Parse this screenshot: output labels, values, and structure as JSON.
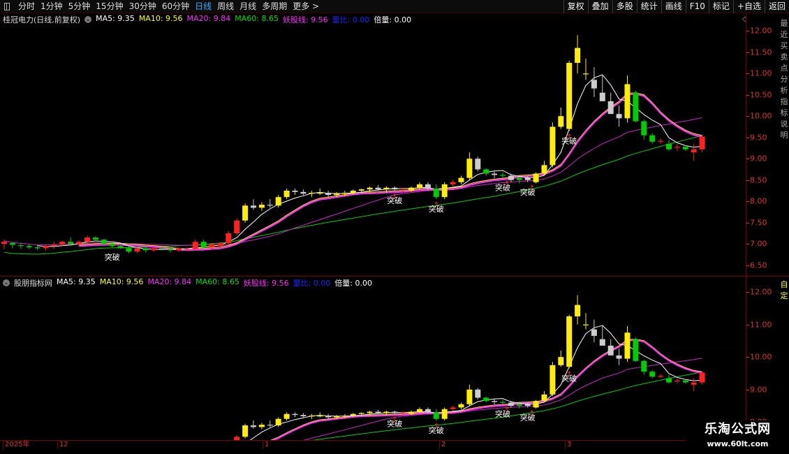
{
  "toolbar": {
    "tabs": [
      "分时",
      "1分钟",
      "5分钟",
      "15分钟",
      "30分钟",
      "60分钟",
      "日线",
      "周线",
      "月线",
      "多周期",
      "更多 >"
    ],
    "active_tab": "日线",
    "tools": [
      "复权",
      "叠加",
      "多股",
      "统计",
      "画线",
      "F10",
      "标记",
      "+自选",
      "返回"
    ]
  },
  "panel1": {
    "title": "桂冠电力(日线,前复权)",
    "indicators": [
      {
        "label": "MA5: 9.35",
        "color": "#ffffff"
      },
      {
        "label": "MA10: 9.56",
        "color": "#ffff00"
      },
      {
        "label": "MA20: 9.84",
        "color": "#ff2bff"
      },
      {
        "label": "MA60: 8.65",
        "color": "#00e000"
      },
      {
        "label": "妖股线: 9.56",
        "color": "#ff2bff"
      },
      {
        "label": "量比: 0.00",
        "color": "#2222ff"
      },
      {
        "label": "倍量: 0.00",
        "color": "#ffffff"
      }
    ],
    "ticks": [
      "12.00",
      "11.50",
      "11.00",
      "10.50",
      "10.00",
      "9.50",
      "9.00",
      "8.50",
      "8.00",
      "7.50",
      "7.00",
      "6.50"
    ],
    "side_text": "最近买卖点分析指标说明"
  },
  "panel2": {
    "title": "股朋指标网",
    "indicators": [
      {
        "label": "MA5: 9.35",
        "color": "#ffffff"
      },
      {
        "label": "MA10: 9.56",
        "color": "#ffff00"
      },
      {
        "label": "MA20: 9.84",
        "color": "#ff2bff"
      },
      {
        "label": "MA60: 8.65",
        "color": "#00e000"
      },
      {
        "label": "妖股线: 9.56",
        "color": "#ff2bff"
      },
      {
        "label": "量比: 0.00",
        "color": "#2222ff"
      },
      {
        "label": "倍量: 0.00",
        "color": "#ffffff"
      }
    ],
    "ticks": [
      "12.00",
      "11.00",
      "10.00",
      "9.00",
      "8.00"
    ],
    "side_text": "自定"
  },
  "signal_label": "突破",
  "dates": [
    "2025年",
    "12",
    "1",
    "2",
    "3"
  ],
  "watermark": {
    "line1": "乐淘公式网",
    "line2": "www.60lt.com"
  },
  "chart_data": {
    "type": "candlestick",
    "ohlc": [
      [
        7.0,
        7.1,
        6.88,
        7.05
      ],
      [
        7.02,
        7.05,
        6.9,
        6.98
      ],
      [
        6.97,
        7.02,
        6.88,
        6.95
      ],
      [
        6.95,
        7.0,
        6.88,
        6.92
      ],
      [
        6.92,
        6.98,
        6.85,
        6.9
      ],
      [
        6.9,
        6.98,
        6.85,
        6.95
      ],
      [
        6.95,
        7.05,
        6.88,
        6.98
      ],
      [
        6.98,
        7.08,
        6.95,
        7.05
      ],
      [
        7.05,
        7.15,
        6.95,
        7.0
      ],
      [
        7.0,
        7.08,
        6.95,
        7.05
      ],
      [
        7.05,
        7.2,
        7.0,
        7.15
      ],
      [
        7.15,
        7.18,
        7.05,
        7.1
      ],
      [
        7.1,
        7.12,
        6.95,
        7.0
      ],
      [
        7.0,
        7.05,
        6.92,
        6.95
      ],
      [
        6.95,
        7.0,
        6.88,
        6.9
      ],
      [
        6.9,
        6.95,
        6.78,
        6.82
      ],
      [
        6.82,
        6.92,
        6.78,
        6.9
      ],
      [
        6.9,
        6.95,
        6.8,
        6.85
      ],
      [
        6.85,
        6.92,
        6.82,
        6.9
      ],
      [
        6.9,
        6.95,
        6.85,
        6.88
      ],
      [
        6.88,
        6.92,
        6.8,
        6.85
      ],
      [
        6.85,
        6.92,
        6.82,
        6.9
      ],
      [
        6.88,
        6.92,
        6.84,
        6.88
      ],
      [
        6.88,
        7.1,
        6.85,
        7.05
      ],
      [
        7.05,
        7.1,
        6.9,
        6.92
      ],
      [
        6.92,
        7.02,
        6.88,
        7.0
      ],
      [
        6.95,
        7.05,
        6.92,
        7.02
      ],
      [
        7.02,
        7.3,
        7.0,
        7.25
      ],
      [
        7.25,
        7.6,
        7.2,
        7.55
      ],
      [
        7.55,
        7.95,
        7.5,
        7.9
      ],
      [
        7.9,
        8.05,
        7.8,
        7.85
      ],
      [
        7.85,
        7.98,
        7.78,
        7.92
      ],
      [
        7.92,
        8.05,
        7.85,
        7.9
      ],
      [
        7.9,
        8.15,
        7.85,
        8.1
      ],
      [
        8.1,
        8.3,
        8.05,
        8.25
      ],
      [
        8.25,
        8.3,
        8.15,
        8.22
      ],
      [
        8.22,
        8.28,
        8.15,
        8.18
      ],
      [
        8.18,
        8.25,
        8.1,
        8.2
      ],
      [
        8.2,
        8.3,
        8.15,
        8.2
      ],
      [
        8.2,
        8.25,
        8.1,
        8.15
      ],
      [
        8.15,
        8.22,
        8.1,
        8.18
      ],
      [
        8.18,
        8.25,
        8.12,
        8.2
      ],
      [
        8.2,
        8.28,
        8.15,
        8.25
      ],
      [
        8.25,
        8.3,
        8.18,
        8.28
      ],
      [
        8.28,
        8.35,
        8.2,
        8.32
      ],
      [
        8.32,
        8.38,
        8.25,
        8.28
      ],
      [
        8.28,
        8.35,
        8.2,
        8.32
      ],
      [
        8.32,
        8.35,
        8.25,
        8.28
      ],
      [
        8.28,
        8.32,
        8.22,
        8.3
      ],
      [
        8.25,
        8.35,
        8.22,
        8.32
      ],
      [
        8.32,
        8.45,
        8.28,
        8.4
      ],
      [
        8.4,
        8.45,
        8.25,
        8.3
      ],
      [
        8.3,
        8.4,
        8.05,
        8.1
      ],
      [
        8.1,
        8.45,
        8.05,
        8.4
      ],
      [
        8.4,
        8.5,
        8.35,
        8.45
      ],
      [
        8.45,
        8.6,
        8.4,
        8.55
      ],
      [
        8.55,
        9.15,
        8.5,
        9.0
      ],
      [
        9.0,
        9.05,
        8.7,
        8.75
      ],
      [
        8.75,
        8.78,
        8.6,
        8.65
      ],
      [
        8.65,
        8.7,
        8.55,
        8.62
      ],
      [
        8.62,
        8.68,
        8.55,
        8.6
      ],
      [
        8.6,
        8.65,
        8.45,
        8.5
      ],
      [
        8.5,
        8.58,
        8.42,
        8.55
      ],
      [
        8.55,
        8.6,
        8.45,
        8.5
      ],
      [
        8.45,
        8.68,
        8.42,
        8.65
      ],
      [
        8.65,
        8.95,
        8.6,
        8.85
      ],
      [
        8.85,
        9.85,
        8.8,
        9.75
      ],
      [
        9.75,
        10.2,
        9.7,
        10.0
      ],
      [
        9.7,
        11.3,
        9.65,
        11.25
      ],
      [
        11.25,
        11.9,
        11.0,
        11.6
      ],
      [
        11.0,
        11.35,
        10.85,
        11.0
      ],
      [
        10.85,
        11.15,
        10.45,
        10.65
      ],
      [
        10.55,
        10.95,
        10.35,
        10.35
      ],
      [
        10.35,
        10.55,
        10.05,
        10.05
      ],
      [
        10.05,
        10.25,
        9.75,
        9.95
      ],
      [
        9.95,
        10.95,
        9.85,
        10.75
      ],
      [
        10.55,
        10.6,
        9.85,
        9.88
      ],
      [
        9.88,
        9.92,
        9.45,
        9.55
      ],
      [
        9.55,
        9.6,
        9.35,
        9.4
      ],
      [
        9.4,
        9.48,
        9.35,
        9.42
      ],
      [
        9.35,
        9.45,
        9.18,
        9.22
      ],
      [
        9.28,
        9.35,
        9.18,
        9.28
      ],
      [
        9.28,
        9.32,
        9.18,
        9.22
      ],
      [
        9.15,
        9.35,
        8.95,
        9.22
      ],
      [
        9.22,
        9.55,
        9.15,
        9.52
      ]
    ],
    "ma5_last": 9.35,
    "ma10_last": 9.56,
    "ma20_last": 9.84,
    "ma60_last": 8.65,
    "signal_bars": [
      13,
      47,
      52,
      60,
      63,
      68
    ],
    "p1_range": [
      6.25,
      12.25
    ],
    "p2_range": [
      7.45,
      12.3
    ]
  }
}
